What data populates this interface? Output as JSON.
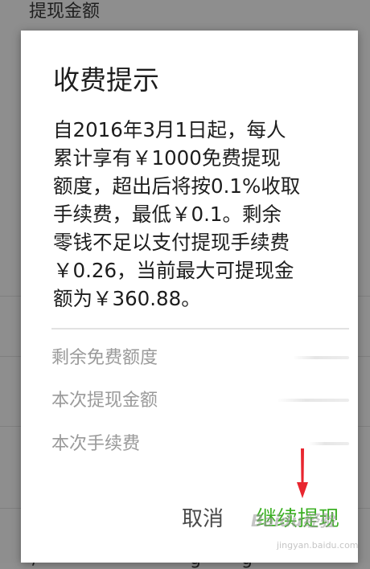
{
  "background": {
    "header_label": "提现金额",
    "bottom_fragments": [
      "/",
      "g",
      "g"
    ]
  },
  "dialog": {
    "title": "收费提示",
    "message_lines": [
      "自2016年3月1日起，每人",
      "累计享有￥1000免费提现",
      "额度，超出后将按0.1%收取",
      "手续费，最低￥0.1。剩余",
      "零钱不足以支付提现手续费",
      "￥0.26，当前最大可提现金",
      "额为￥360.88。"
    ],
    "info_rows": [
      {
        "label": "剩余免费额度"
      },
      {
        "label": "本次提现金额"
      },
      {
        "label": "本次手续费"
      }
    ],
    "buttons": {
      "cancel": "取消",
      "continue": "继续提现"
    }
  },
  "watermark": {
    "brand": "Baidu经验",
    "sub": "jingyan.baidu.com"
  },
  "colors": {
    "backdrop": "#8e8e8e",
    "dialog_bg": "#ffffff",
    "continue_button": "#3cb024",
    "cancel_button": "#4a4a4a",
    "label_gray": "#9a9a9a",
    "annotation_arrow": "#e8262f"
  },
  "icons": {
    "annotation": "red-arrow-down-icon"
  }
}
